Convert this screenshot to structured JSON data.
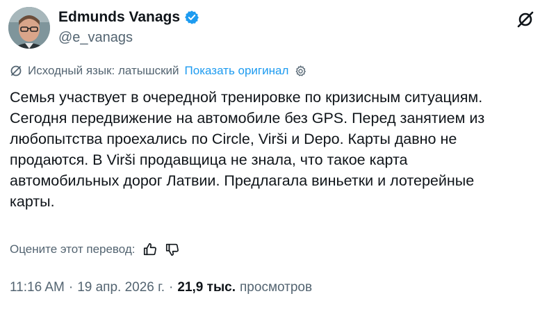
{
  "author": {
    "display_name": "Edmunds Vanags",
    "handle": "@e_vanags",
    "verified": true,
    "verified_color": "#1d9bf0"
  },
  "translation": {
    "source_label": "Исходный язык: латышский",
    "show_original": "Показать оригинал"
  },
  "tweet": {
    "text": "Семья участвует в очередной тренировке по кризисным ситуациям.\nСегодня передвижение на автомобиле без GPS. Перед занятием из\nлюбопытства проехались по Circle, Virši и Depo. Карты давно не\nпродаются. В Virši продавщица не знала, что такое карта\nавтомобильных дорог Латвии. Предлагала виньетки и лотерейные\nкарты."
  },
  "rate": {
    "label": "Оцените этот перевод:"
  },
  "meta": {
    "time": "11:16 AM",
    "sep1": "·",
    "date": "19 апр. 2026 г.",
    "sep2": "·",
    "views_count": "21,9 тыс.",
    "views_label": "просмотров"
  },
  "colors": {
    "text": "#0f1419",
    "secondary": "#536471",
    "link": "#1d9bf0"
  },
  "icons": [
    "verified-badge-icon",
    "grok-icon",
    "translate-icon",
    "gear-icon",
    "thumbs-up-icon",
    "thumbs-down-icon"
  ]
}
